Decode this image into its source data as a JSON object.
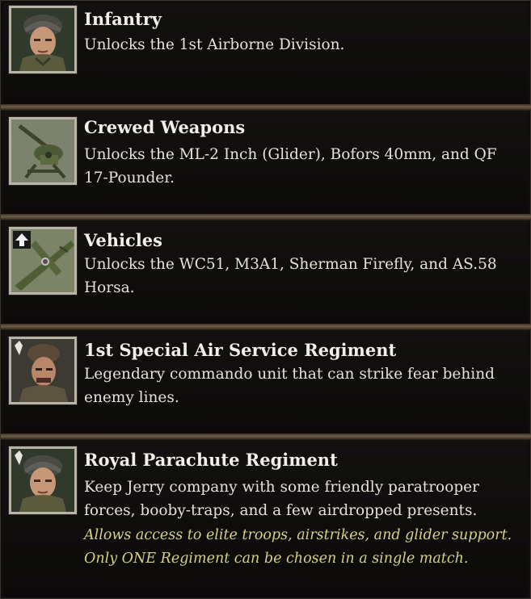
{
  "unlocks": [
    {
      "icon": "infantry-soldier-portrait",
      "title": "Infantry",
      "description": "Unlocks the 1st Airborne Division."
    },
    {
      "icon": "anti-aircraft-gun-icon",
      "title": "Crewed Weapons",
      "description": "Unlocks the ML-2 Inch (Glider), Bofors 40mm, and QF 17-Pounder."
    },
    {
      "icon": "glider-aircraft-icon",
      "title": "Vehicles",
      "description": "Unlocks the WC51, M3A1, Sherman Firefly, and AS.58 Horsa."
    },
    {
      "icon": "commando-portrait",
      "title": "1st Special Air Service Regiment",
      "description": "Legendary commando unit that can strike fear behind enemy lines."
    },
    {
      "icon": "paratrooper-portrait",
      "title": "Royal Parachute Regiment",
      "description": "Keep Jerry company with some friendly paratrooper forces, booby-traps, and a few airdropped presents.",
      "note": "Allows access to elite troops, airstrikes, and glider support. Only ONE Regiment can be chosen in a single match."
    }
  ],
  "colors": {
    "title": "#f2efe8",
    "description": "#e6e2d8",
    "note": "#d6cf86",
    "separator": "#6e5d44"
  }
}
